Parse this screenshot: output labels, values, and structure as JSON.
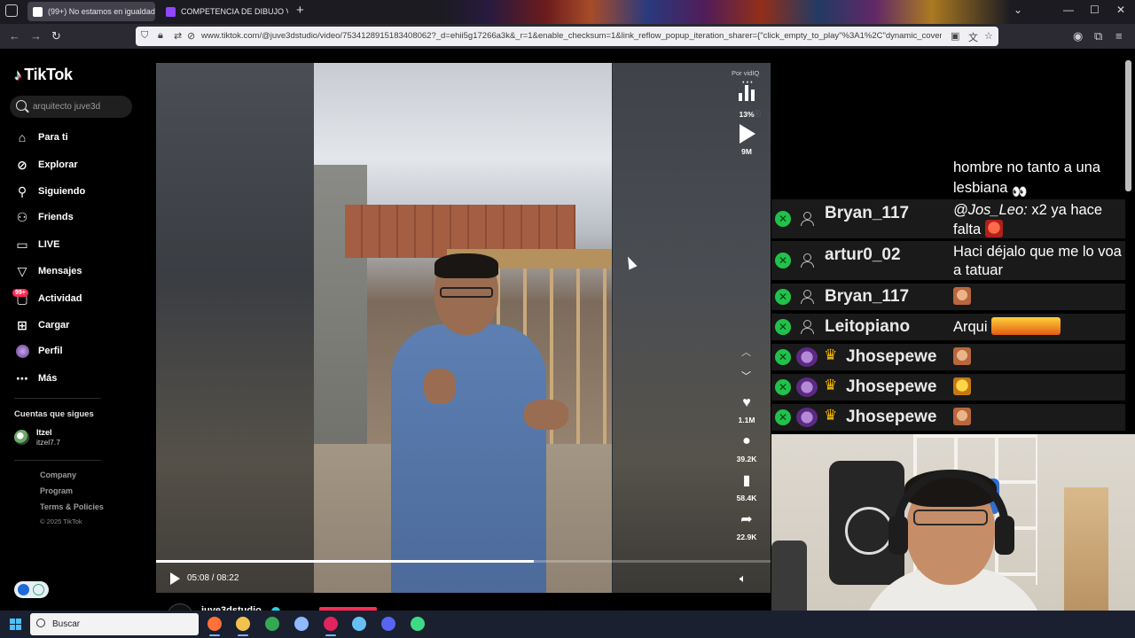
{
  "browser": {
    "tabs": [
      {
        "title": "(99+) No estamos en igualdad d",
        "active": true
      },
      {
        "title": "COMPETENCIA DE DIBUJO VS M",
        "active": false
      }
    ],
    "new_tab": "+",
    "url": "www.tiktok.com/@juve3dstudio/video/7534128915183408062?_d=ehii5g17266a3k&_r=1&enable_checksum=1&link_reflow_popup_iteration_sharer={\"click_empty_to_play\"%3A1%2C\"dynamic_cover\"%3A1%",
    "window_controls": {
      "minimize": "—",
      "maximize": "☐",
      "close": "✕"
    }
  },
  "tiktok": {
    "logo": "TikTok",
    "search_placeholder": "arquitecto juve3d",
    "nav": [
      {
        "label": "Para ti",
        "icon": "home-icon"
      },
      {
        "label": "Explorar",
        "icon": "compass-icon"
      },
      {
        "label": "Siguiendo",
        "icon": "user-follow-icon"
      },
      {
        "label": "Friends",
        "icon": "friends-icon"
      },
      {
        "label": "LIVE",
        "icon": "live-icon"
      },
      {
        "label": "Mensajes",
        "icon": "send-icon"
      },
      {
        "label": "Actividad",
        "icon": "inbox-icon"
      },
      {
        "label": "Cargar",
        "icon": "upload-icon"
      },
      {
        "label": "Perfil",
        "icon": "avatar-icon"
      },
      {
        "label": "Más",
        "icon": "more-icon"
      }
    ],
    "activity_badge": "99+",
    "following_title": "Cuentas que sigues",
    "following": [
      {
        "name": "Itzel",
        "handle": "itzel7.7"
      }
    ],
    "footer": [
      "Company",
      "Program",
      "Terms & Policies"
    ],
    "copyright": "© 2025 TikTok",
    "video": {
      "vidiq_label": "Por vidIQ",
      "score": "13%",
      "views": "9M",
      "likes": "1.1M",
      "comments": "39.2K",
      "saves": "58.4K",
      "shares": "22.9K",
      "time": "05:08 / 08:22",
      "progress": 0.615,
      "author": "juve3dstudio"
    }
  },
  "chat": {
    "top_message": "hombre no tanto a una lesbiana",
    "rows": [
      {
        "user": "Bryan_117",
        "mention": "@Jos_Leo:",
        "message": "x2 ya hace falta",
        "emote": "em-red",
        "badge": "person"
      },
      {
        "user": "artur0_02",
        "mention": "",
        "message": "Haci déjalo que me lo voa a tatuar",
        "emote": "",
        "badge": "person"
      },
      {
        "user": "Bryan_117",
        "mention": "",
        "message": "",
        "emote": "em-face",
        "badge": "person"
      },
      {
        "user": "Leitopiano",
        "mention": "",
        "message": "Arqui",
        "emote": "em-fire",
        "badge": "person"
      },
      {
        "user": "Jhosepewe",
        "mention": "",
        "message": "",
        "emote": "em-face",
        "badge": "sub"
      },
      {
        "user": "Jhosepewe",
        "mention": "",
        "message": "",
        "emote": "em-gold",
        "badge": "sub"
      },
      {
        "user": "Jhosepewe",
        "mention": "",
        "message": "",
        "emote": "em-face",
        "badge": "sub"
      }
    ]
  },
  "taskbar": {
    "search_placeholder": "Buscar",
    "apps": [
      {
        "name": "firefox-icon",
        "color": "#ff7139"
      },
      {
        "name": "file-explorer-icon",
        "color": "#f2c14e"
      },
      {
        "name": "chrome-icon",
        "color": "#34a853"
      },
      {
        "name": "ccleaner-icon",
        "color": "#8fb8ff"
      },
      {
        "name": "opera-gx-icon",
        "color": "#e0245e"
      },
      {
        "name": "steam-icon",
        "color": "#66c0f4"
      },
      {
        "name": "discord-icon",
        "color": "#5865f2"
      },
      {
        "name": "obs-like-icon",
        "color": "#3ddc84"
      }
    ]
  }
}
